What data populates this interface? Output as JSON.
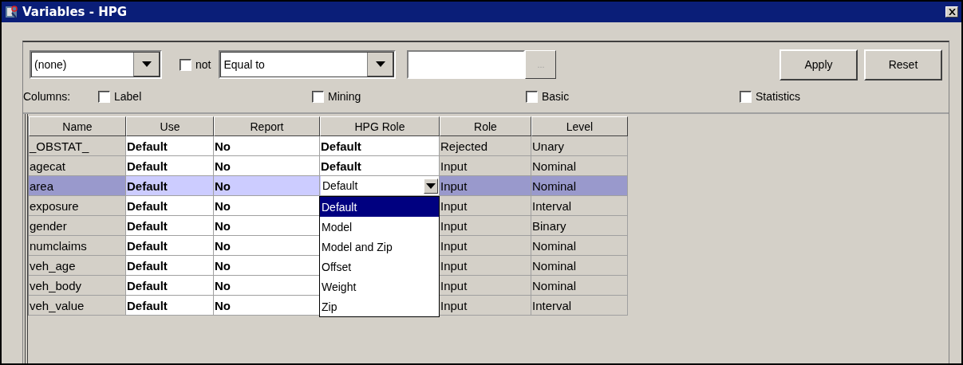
{
  "window": {
    "title": "Variables - HPG"
  },
  "filter": {
    "variable": {
      "value": "(none)"
    },
    "not": {
      "label": "not",
      "checked": false
    },
    "operator": {
      "value": "Equal to"
    },
    "browse": {
      "label": "...",
      "disabled": true
    },
    "buttons": [
      "Apply",
      "Reset"
    ]
  },
  "columns_options": {
    "label": "Columns:",
    "items": [
      {
        "label": "Label",
        "checked": false
      },
      {
        "label": "Mining",
        "checked": false
      },
      {
        "label": "Basic",
        "checked": false
      },
      {
        "label": "Statistics",
        "checked": false
      }
    ]
  },
  "table": {
    "columns": [
      "Name",
      "Use",
      "Report",
      "HPG Role",
      "Role",
      "Level"
    ],
    "rows": [
      {
        "name": "_OBSTAT_",
        "use": "Default",
        "report": "No",
        "hpg_role": "Default",
        "role": "Rejected",
        "level": "Unary",
        "selected": false
      },
      {
        "name": "agecat",
        "use": "Default",
        "report": "No",
        "hpg_role": "Default",
        "role": "Input",
        "level": "Nominal",
        "selected": false
      },
      {
        "name": "area",
        "use": "Default",
        "report": "No",
        "hpg_role_editor": {
          "value": "Default",
          "options": [
            {
              "label": "Default",
              "selected": true
            },
            {
              "label": "Model",
              "selected": false
            },
            {
              "label": "Model and Zip",
              "selected": false
            },
            {
              "label": "Offset",
              "selected": false
            },
            {
              "label": "Weight",
              "selected": false
            },
            {
              "label": "Zip",
              "selected": false
            }
          ]
        },
        "role": "Input",
        "level": "Nominal",
        "selected": true
      },
      {
        "name": "exposure",
        "use": "Default",
        "report": "No",
        "role": "Input",
        "level": "Interval",
        "selected": false
      },
      {
        "name": "gender",
        "use": "Default",
        "report": "No",
        "role": "Input",
        "level": "Binary",
        "selected": false
      },
      {
        "name": "numclaims",
        "use": "Default",
        "report": "No",
        "role": "Input",
        "level": "Nominal",
        "selected": false
      },
      {
        "name": "veh_age",
        "use": "Default",
        "report": "No",
        "role": "Input",
        "level": "Nominal",
        "selected": false
      },
      {
        "name": "veh_body",
        "use": "Default",
        "report": "No",
        "role": "Input",
        "level": "Nominal",
        "selected": false
      },
      {
        "name": "veh_value",
        "use": "Default",
        "report": "No",
        "role": "Input",
        "level": "Interval",
        "selected": false
      }
    ]
  }
}
